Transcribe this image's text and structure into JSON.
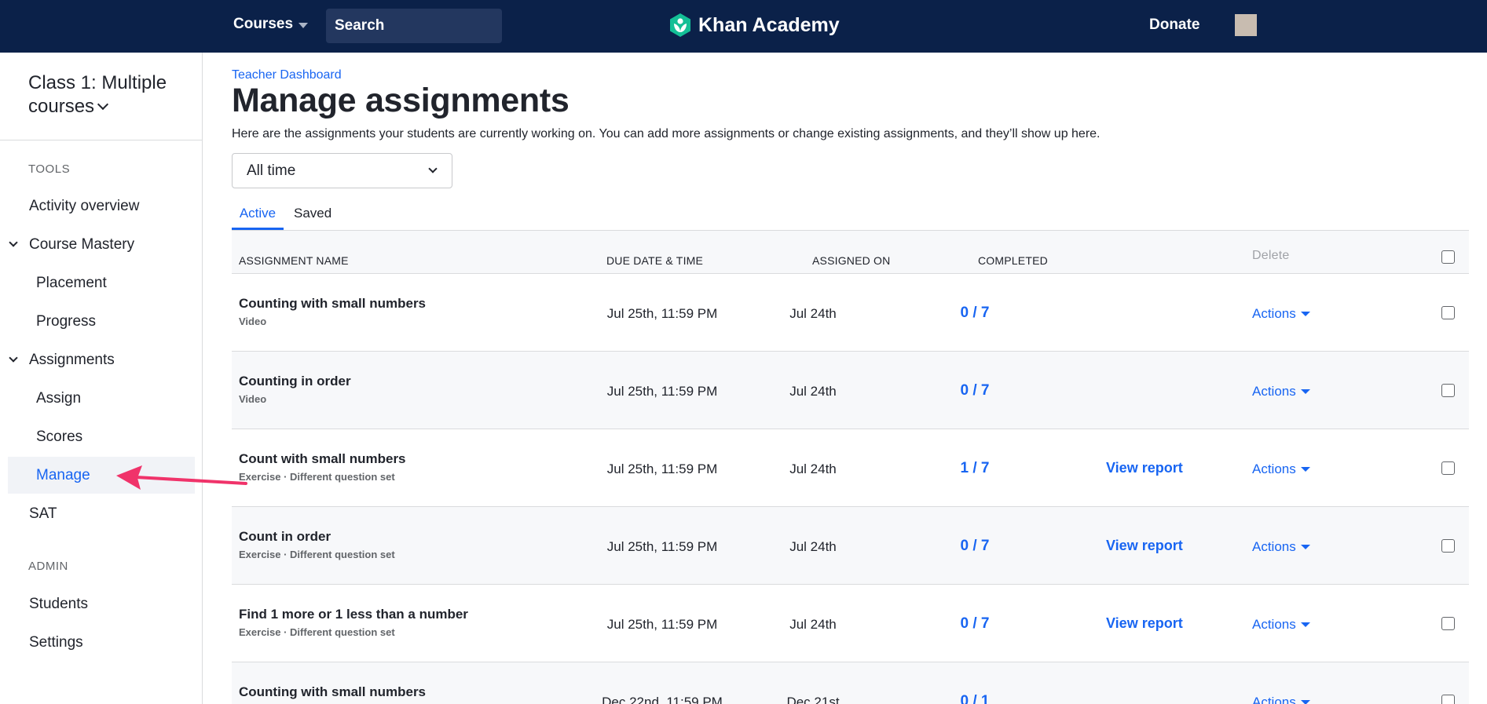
{
  "topbar": {
    "courses_label": "Courses",
    "search_placeholder": "Search",
    "logo_text": "Khan Academy",
    "donate_label": "Donate",
    "brand_color": "#0b2149",
    "accent_color": "#1865f2"
  },
  "sidebar": {
    "class_title": "Class 1: Multiple courses",
    "tools_heading": "TOOLS",
    "activity_overview": "Activity overview",
    "course_mastery": "Course Mastery",
    "placement": "Placement",
    "progress": "Progress",
    "assignments": "Assignments",
    "assign": "Assign",
    "scores": "Scores",
    "manage": "Manage",
    "sat": "SAT",
    "admin_heading": "ADMIN",
    "students": "Students",
    "settings": "Settings"
  },
  "main": {
    "breadcrumb": "Teacher Dashboard",
    "title": "Manage assignments",
    "description": "Here are the assignments your students are currently working on. You can add more assignments or change existing assignments, and they’ll show up here.",
    "filter_value": "All time",
    "tabs": [
      {
        "label": "Active",
        "active": true
      },
      {
        "label": "Saved",
        "active": false
      }
    ]
  },
  "table": {
    "headers": {
      "name": "ASSIGNMENT NAME",
      "due": "DUE DATE & TIME",
      "assigned_on": "ASSIGNED ON",
      "completed": "COMPLETED",
      "delete": "Delete"
    },
    "rows": [
      {
        "name": "Counting with small numbers",
        "type": "Video",
        "due": "Jul 25th, 11:59 PM",
        "assigned_on": "Jul 24th",
        "completed": "0 / 7",
        "report": "",
        "actions": "Actions"
      },
      {
        "name": "Counting in order",
        "type": "Video",
        "due": "Jul 25th, 11:59 PM",
        "assigned_on": "Jul 24th",
        "completed": "0 / 7",
        "report": "",
        "actions": "Actions"
      },
      {
        "name": "Count with small numbers",
        "type": "Exercise · Different question set",
        "due": "Jul 25th, 11:59 PM",
        "assigned_on": "Jul 24th",
        "completed": "1 / 7",
        "report": "View report",
        "actions": "Actions"
      },
      {
        "name": "Count in order",
        "type": "Exercise · Different question set",
        "due": "Jul 25th, 11:59 PM",
        "assigned_on": "Jul 24th",
        "completed": "0 / 7",
        "report": "View report",
        "actions": "Actions"
      },
      {
        "name": "Find 1 more or 1 less than a number",
        "type": "Exercise · Different question set",
        "due": "Jul 25th, 11:59 PM",
        "assigned_on": "Jul 24th",
        "completed": "0 / 7",
        "report": "View report",
        "actions": "Actions"
      },
      {
        "name": "Counting with small numbers",
        "type": "",
        "due": "Dec 22nd, 11:59 PM",
        "assigned_on": "Dec 21st",
        "completed": "0 / 1",
        "report": "",
        "actions": "Actions"
      }
    ]
  }
}
